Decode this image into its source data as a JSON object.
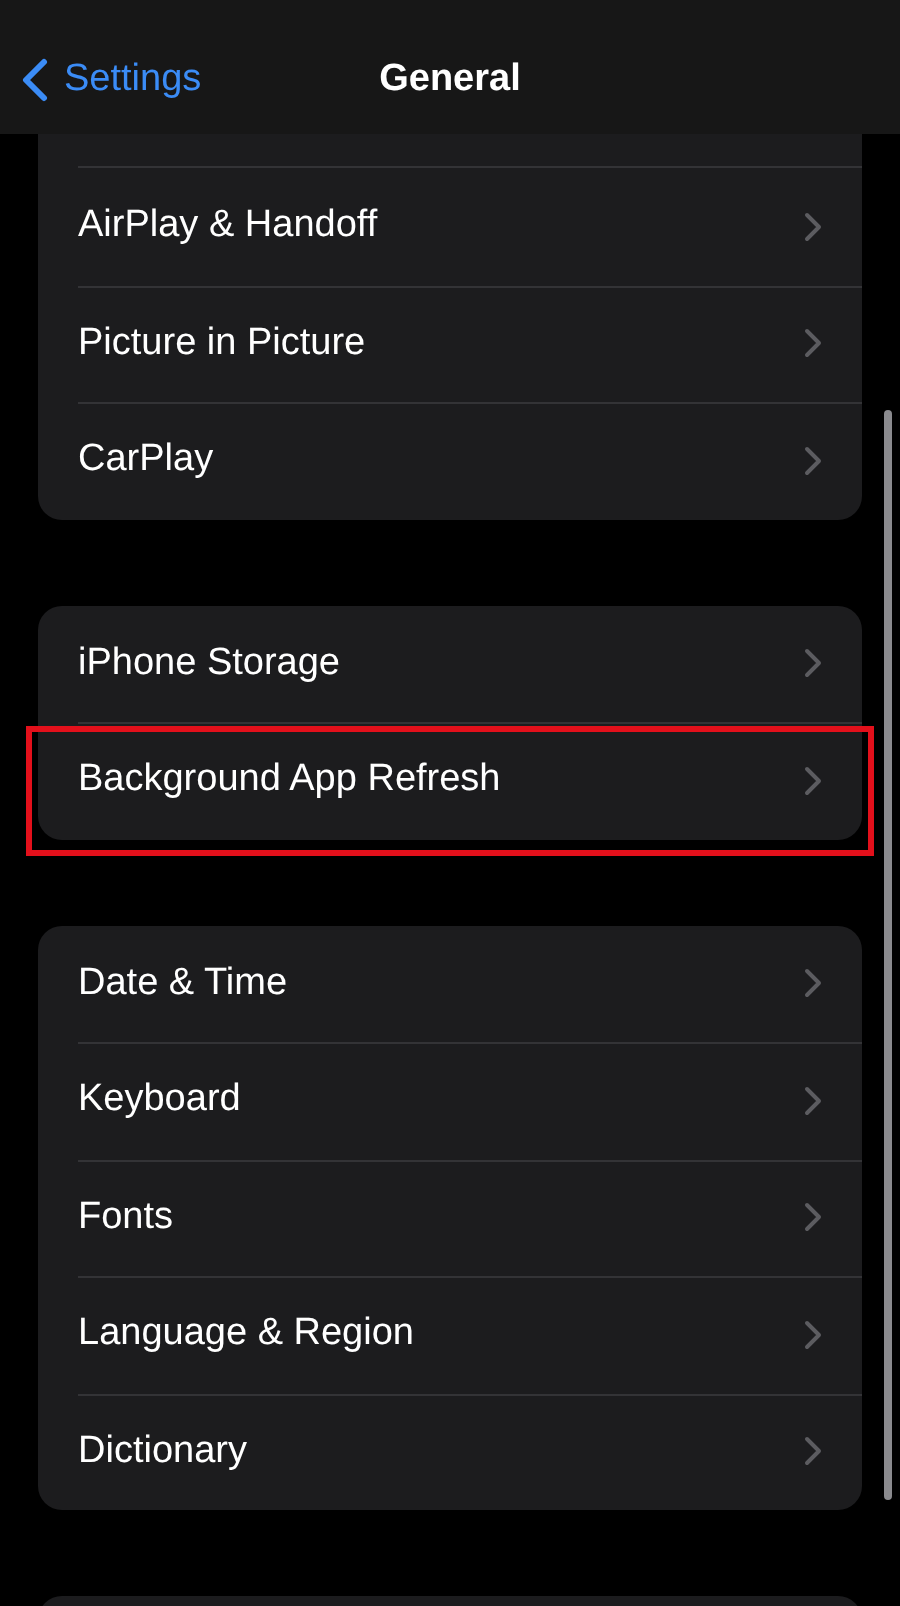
{
  "nav": {
    "back": "Settings",
    "title": "General"
  },
  "groups": [
    {
      "rows": [
        {
          "label": "AirPlay & Handoff",
          "highlighted": false
        },
        {
          "label": "Picture in Picture",
          "highlighted": false
        },
        {
          "label": "CarPlay",
          "highlighted": false
        }
      ]
    },
    {
      "rows": [
        {
          "label": "iPhone Storage",
          "highlighted": false
        },
        {
          "label": "Background App Refresh",
          "highlighted": true
        }
      ]
    },
    {
      "rows": [
        {
          "label": "Date & Time",
          "highlighted": false
        },
        {
          "label": "Keyboard",
          "highlighted": false
        },
        {
          "label": "Fonts",
          "highlighted": false
        },
        {
          "label": "Language & Region",
          "highlighted": false
        },
        {
          "label": "Dictionary",
          "highlighted": false
        }
      ]
    }
  ]
}
